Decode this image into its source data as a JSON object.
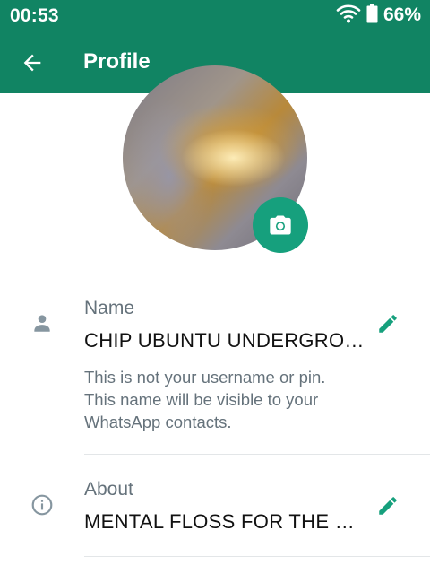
{
  "status_bar": {
    "time": "00:53",
    "battery": "66%",
    "icons": [
      "wifi-icon",
      "battery-icon"
    ]
  },
  "app_bar": {
    "title": "Profile",
    "back_icon": "arrow-back-icon"
  },
  "profile": {
    "photo_alt": "Profile photo",
    "camera_icon": "camera-icon"
  },
  "name_section": {
    "label": "Name",
    "value": "CHIP UBUNTU UNDERGROUND",
    "helper_lines": [
      "This is not your username or pin.",
      "This name will be visible to your",
      "WhatsApp contacts."
    ]
  },
  "about_section": {
    "label": "About",
    "value": "MENTAL FLOSS FOR THE MIND"
  },
  "colors": {
    "primary": "#118463",
    "accent": "#16a07d",
    "secondary_text": "#65727b"
  }
}
